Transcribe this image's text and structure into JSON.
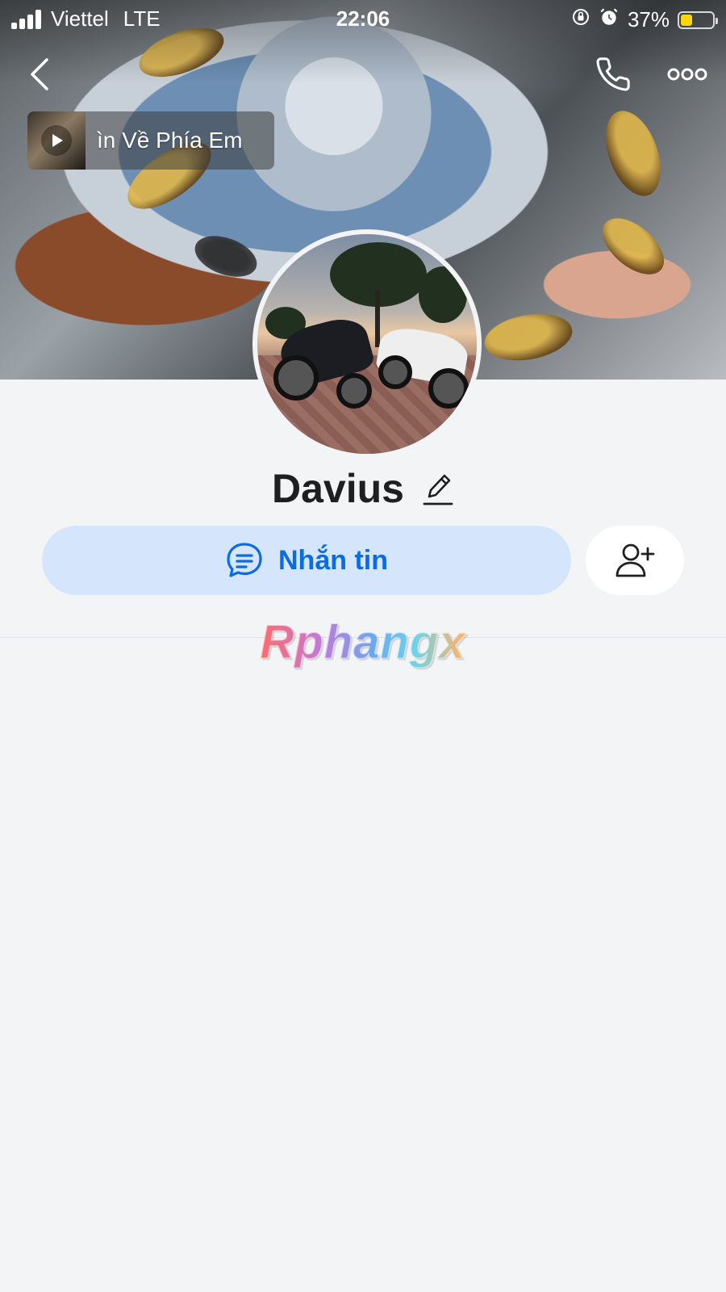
{
  "status_bar": {
    "carrier": "Viettel",
    "network": "LTE",
    "time": "22:06",
    "battery": "37%",
    "battery_level": 0.37,
    "battery_color": "#ffd60a"
  },
  "top_nav": {
    "back_icon": "chevron-left-icon",
    "call_icon": "phone-icon",
    "more_icon": "more-dots-icon"
  },
  "music": {
    "title": "ìn Về Phía Em",
    "play_icon": "play-icon"
  },
  "profile": {
    "name": "Davius",
    "edit_icon": "pencil-icon"
  },
  "actions": {
    "message_label": "Nhắn tin",
    "message_icon": "chat-bubble-icon",
    "add_friend_icon": "add-user-icon",
    "accent_color": "#0b6be3",
    "message_bg": "#d4e5fc"
  },
  "watermark": {
    "text": "Rphangx"
  }
}
